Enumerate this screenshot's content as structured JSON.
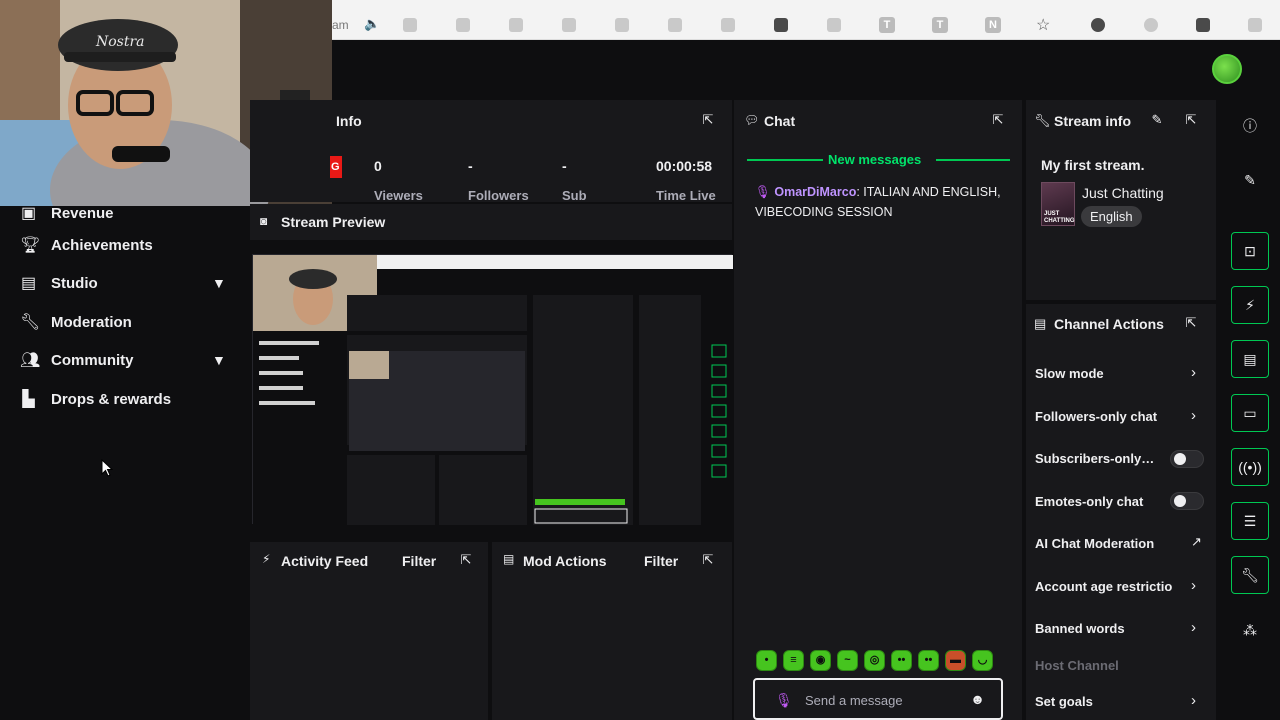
{
  "browser": {
    "url_fragment": "am"
  },
  "webcam": {
    "cap_text": "Nostra"
  },
  "topbar": {
    "avatar_name": "user-avatar"
  },
  "sidebar": {
    "items": [
      {
        "label": "Revenue",
        "icon": "revenue-icon"
      },
      {
        "label": "Achievements",
        "icon": "trophy-icon"
      },
      {
        "label": "Studio",
        "icon": "studio-icon",
        "has_chevron": true
      },
      {
        "label": "Moderation",
        "icon": "wrench-icon"
      },
      {
        "label": "Community",
        "icon": "community-icon",
        "has_chevron": true
      },
      {
        "label": "Drops & rewards",
        "icon": "drops-icon"
      }
    ]
  },
  "stats_panel": {
    "title": "Info",
    "live_badge": "G",
    "stats": [
      {
        "value": "0",
        "label": "Viewers"
      },
      {
        "value": "-",
        "label": "Followers"
      },
      {
        "value": "-",
        "label": "Sub"
      },
      {
        "value": "00:00:58",
        "label": "Time Live"
      }
    ]
  },
  "preview": {
    "title": "Stream Preview"
  },
  "activity_feed": {
    "title": "Activity Feed",
    "filter_label": "Filter"
  },
  "mod_actions": {
    "title": "Mod Actions",
    "filter_label": "Filter"
  },
  "chat": {
    "title": "Chat",
    "new_messages_label": "New messages",
    "messages": [
      {
        "user": "OmarDiMarco",
        "text": "ITALIAN AND ENGLISH, VIBECODING SESSION"
      }
    ],
    "input_placeholder": "Send a message",
    "emote_count": 9
  },
  "stream_info": {
    "title": "Stream info",
    "stream_title": "My first stream.",
    "category": "Just Chatting",
    "category_thumb_text": "JUST CHATTING",
    "language": "English"
  },
  "channel_actions": {
    "title": "Channel Actions",
    "rows": [
      {
        "label": "Slow mode",
        "control": "chevron"
      },
      {
        "label": "Followers-only chat",
        "control": "chevron"
      },
      {
        "label": "Subscribers-only…",
        "control": "toggle",
        "on": false
      },
      {
        "label": "Emotes-only chat",
        "control": "toggle",
        "on": false
      },
      {
        "label": "AI Chat Moderation",
        "control": "external"
      },
      {
        "label": "Account age restrictio",
        "control": "chevron"
      },
      {
        "label": "Banned words",
        "control": "chevron"
      },
      {
        "label": "Host Channel",
        "control": "none",
        "disabled": true
      },
      {
        "label": "Set goals",
        "control": "chevron"
      }
    ]
  },
  "quick_actions": {
    "rail_icons": [
      "info-icon",
      "pencil-icon"
    ],
    "buttons": [
      "clip-icon",
      "lightning-icon",
      "notes-icon",
      "chat-bubble-icon",
      "broadcast-icon",
      "layout-icon",
      "wrench-icon"
    ],
    "bottom_icon": "share-icon"
  },
  "colors": {
    "accent_green": "#00c853",
    "username_purple": "#bf94ff",
    "panel_bg": "#18181b",
    "app_bg": "#0e0e10"
  }
}
